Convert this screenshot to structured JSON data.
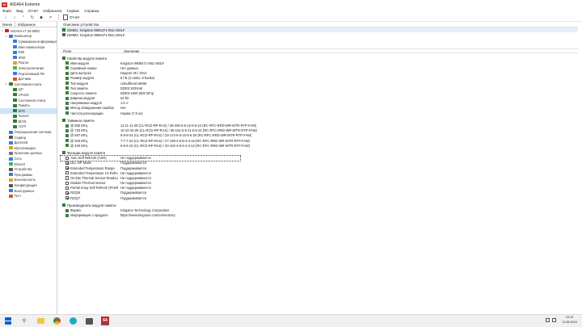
{
  "window": {
    "title": "AIDA64 Extreme",
    "app_icon": "64"
  },
  "menu": [
    "Файл",
    "Вид",
    "Отчёт",
    "Избранное",
    "Сервис",
    "Справка"
  ],
  "toolbar": {
    "report_label": "Отчёт"
  },
  "left_panel": {
    "tabs": [
      "Меню",
      "Избранное"
    ],
    "tree": [
      {
        "label": "AIDA64 v7.20.6800",
        "level": 0,
        "color": "#c62828",
        "expanded": true
      },
      {
        "label": "Компьютер",
        "level": 1,
        "color": "#3a7bd5",
        "expanded": true
      },
      {
        "label": "Суммарная информация",
        "level": 2,
        "color": "#3a7bd5"
      },
      {
        "label": "Имя компьютера",
        "level": 2,
        "color": "#3a7bd5"
      },
      {
        "label": "DMI",
        "level": 2,
        "color": "#3a7bd5"
      },
      {
        "label": "IPMI",
        "level": 2,
        "color": "#3a7bd5"
      },
      {
        "label": "Разгон",
        "level": 2,
        "color": "#e0a020"
      },
      {
        "label": "Электропитание",
        "level": 2,
        "color": "#4caf50"
      },
      {
        "label": "Портативный ПК",
        "level": 2,
        "color": "#3a7bd5"
      },
      {
        "label": "Датчики",
        "level": 2,
        "color": "#e05020"
      },
      {
        "label": "Системная плата",
        "level": 1,
        "color": "#2e7d32",
        "expanded": true
      },
      {
        "label": "ЦП",
        "level": 2,
        "color": "#2e7d32"
      },
      {
        "label": "CPUID",
        "level": 2,
        "color": "#2e7d32"
      },
      {
        "label": "Системная плата",
        "level": 2,
        "color": "#2e7d32"
      },
      {
        "label": "Память",
        "level": 2,
        "color": "#2e7d32"
      },
      {
        "label": "SPD",
        "level": 2,
        "color": "#2e7d32",
        "selected": true
      },
      {
        "label": "Чипсет",
        "level": 2,
        "color": "#2e7d32"
      },
      {
        "label": "BIOS",
        "level": 2,
        "color": "#2e7d32"
      },
      {
        "label": "ACPI",
        "level": 2,
        "color": "#2e7d32"
      },
      {
        "label": "Операционная система",
        "level": 1,
        "color": "#3a7bd5"
      },
      {
        "label": "Сервер",
        "level": 1,
        "color": "#555555"
      },
      {
        "label": "Дисплей",
        "level": 1,
        "color": "#3a7bd5"
      },
      {
        "label": "Мультимедиа",
        "level": 1,
        "color": "#e0a020"
      },
      {
        "label": "Хранение данных",
        "level": 1,
        "color": "#777777"
      },
      {
        "label": "Сеть",
        "level": 1,
        "color": "#3a7bd5"
      },
      {
        "label": "DirectX",
        "level": 1,
        "color": "#4caf50"
      },
      {
        "label": "Устройства",
        "level": 1,
        "color": "#555555"
      },
      {
        "label": "Программы",
        "level": 1,
        "color": "#3a7bd5"
      },
      {
        "label": "Безопасность",
        "level": 1,
        "color": "#e0a020"
      },
      {
        "label": "Конфигурация",
        "level": 1,
        "color": "#555555"
      },
      {
        "label": "База данных",
        "level": 1,
        "color": "#3a7bd5"
      },
      {
        "label": "Тест",
        "level": 1,
        "color": "#e05020"
      }
    ]
  },
  "devices": {
    "header": "Описание устройства",
    "items": [
      "DIMM1: Kingston 9905471-052.A00LF",
      "DIMM3: Kingston 9905471-052.A00LF"
    ]
  },
  "columns": {
    "field": "Поле",
    "value": "Значение"
  },
  "sections": [
    {
      "title": "Свойства модуля памяти",
      "rows": [
        {
          "field": "Имя модуля",
          "value": "Kingston 9905471-052.A00LF"
        },
        {
          "field": "Серийный номер",
          "value": "Нет данных"
        },
        {
          "field": "Дата выпуска",
          "value": "Неделя 36 / 2014"
        },
        {
          "field": "Размер модуля",
          "value": "8 ГБ (2 ranks, 8 banks)"
        },
        {
          "field": "Тип модуля",
          "value": "Unbuffered DIMM"
        },
        {
          "field": "Тип памяти",
          "value": "DDR3 SDRAM"
        },
        {
          "field": "Скорость памяти",
          "value": "DDR3-1600 (800 МГц)"
        },
        {
          "field": "Ширина модуля",
          "value": "64 bit"
        },
        {
          "field": "Напряжение модуля",
          "value": "1.5 V"
        },
        {
          "field": "Метод обнаружения ошибок",
          "value": "Нет"
        },
        {
          "field": "Частота регенерации",
          "value": "Норма (7.8 us)"
        }
      ]
    },
    {
      "title": "Тайминги памяти",
      "rows": [
        {
          "field": "@ 800 МГц",
          "value": "11-11-11-28 (CL-RCD-RP-RAS) / 39-208-5-6-12-6-6-24 (RC-RFC-RRD-WR-WTR-RTP-FAW)"
        },
        {
          "field": "@ 733 МГц",
          "value": "10-10-10-26 (CL-RCD-RP-RAS) / 36-191-5-6-11-6-6-22 (RC-RFC-RRD-WR-WTR-RTP-FAW)"
        },
        {
          "field": "@ 667 МГц",
          "value": "9-9-9-24 (CL-RCD-RP-RAS) / 33-174-5-6-10-5-5-20 (RC-RFC-RRD-WR-WTR-RTP-FAW)"
        },
        {
          "field": "@ 533 МГц",
          "value": "7-7-7-20 (CL-RCD-RP-RAS) / 27-139-4-6-8-4-4-16 (RC-RFC-RRD-WR-WTR-RTP-FAW)"
        },
        {
          "field": "@ 400 МГц",
          "value": "6-6-6-15 (CL-RCD-RP-RAS) / 20-104-4-6-6-4-4-12 (RC-RFC-RRD-WR-WTR-RTP-FAW)"
        }
      ]
    },
    {
      "title": "Функции модуля памяти",
      "rows": [
        {
          "field": "Auto Self Refresh (ASR)",
          "value": "Не поддерживается",
          "checked": false,
          "focused": true
        },
        {
          "field": "DLL-Off Mode",
          "value": "Поддерживается",
          "checked": true
        },
        {
          "field": "Extended Temperature Range",
          "value": "Поддерживается",
          "checked": true
        },
        {
          "field": "Extended Temperature 1X Refresh Rate",
          "value": "Не поддерживается",
          "checked": false
        },
        {
          "field": "On-Die Thermal Sensor Readout (ODTS)",
          "value": "Не поддерживается",
          "checked": false
        },
        {
          "field": "Module Thermal Sensor",
          "value": "Не поддерживается",
          "checked": false
        },
        {
          "field": "Partial Array Self Refresh (PASR)",
          "value": "Не поддерживается",
          "checked": false
        },
        {
          "field": "RZQ/6",
          "value": "Поддерживается",
          "checked": true
        },
        {
          "field": "RZQ/7",
          "value": "Поддерживается",
          "checked": true
        }
      ]
    },
    {
      "title": "Производитель модуля памяти",
      "rows": [
        {
          "field": "Фирма",
          "value": "Kingston Technology Corporation"
        },
        {
          "field": "Информация о продукте",
          "value": "https://www.kingston.com/en/memory",
          "link": true
        }
      ]
    }
  ],
  "taskbar": {
    "time": "10:10",
    "date": "11.06.2024",
    "aida_label": "64"
  }
}
